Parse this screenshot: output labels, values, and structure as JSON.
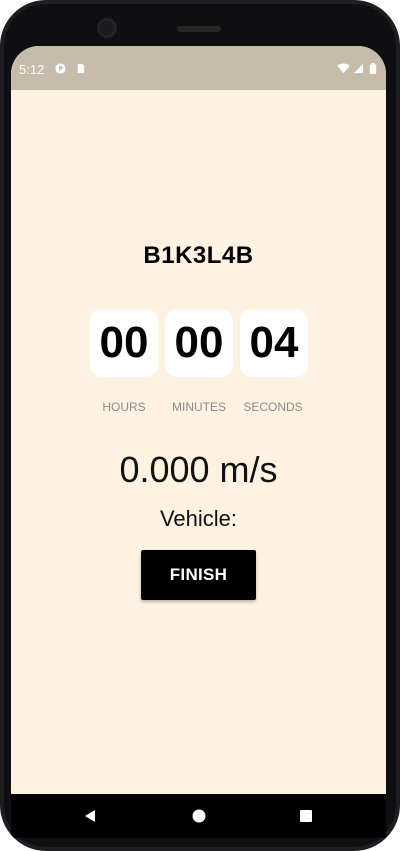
{
  "status_bar": {
    "time": "5:12",
    "icons": [
      "notification-app-icon",
      "sd-card-icon",
      "wifi-icon",
      "signal-icon",
      "battery-icon"
    ],
    "background": "#c7bcaa"
  },
  "app": {
    "background": "#fff2e0",
    "title": "B1K3L4B",
    "timer": {
      "hours": "00",
      "minutes": "00",
      "seconds": "04",
      "hours_label": "HOURS",
      "minutes_label": "MINUTES",
      "seconds_label": "SECONDS"
    },
    "speed": "0.000 m/s",
    "vehicle_label": "Vehicle:",
    "finish_label": "FINISH"
  },
  "nav_bar": {
    "buttons": [
      "back-icon",
      "home-icon",
      "recents-icon"
    ]
  }
}
